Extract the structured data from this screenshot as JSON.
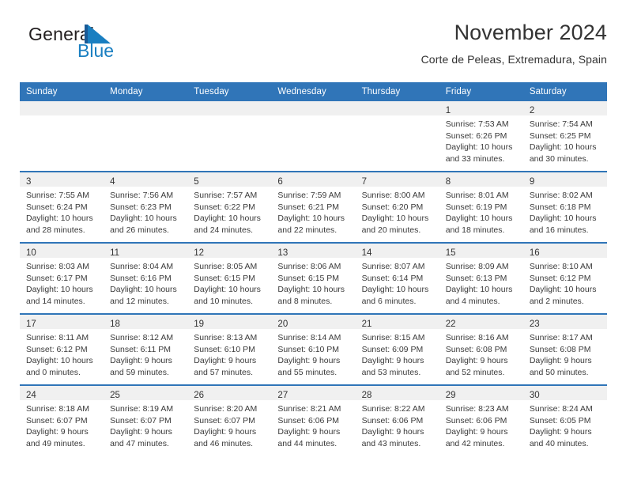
{
  "brand": {
    "name_part1": "General",
    "name_part2": "Blue",
    "accent_color": "#1a7fc1"
  },
  "header": {
    "title": "November 2024",
    "subtitle": "Corte de Peleas, Extremadura, Spain"
  },
  "theme": {
    "header_blue": "#3075b8",
    "daynum_band": "#f0f0f0",
    "text": "#333333"
  },
  "calendar": {
    "weekday_headers": [
      "Sunday",
      "Monday",
      "Tuesday",
      "Wednesday",
      "Thursday",
      "Friday",
      "Saturday"
    ],
    "weeks": [
      [
        {
          "day": "",
          "sunrise": "",
          "sunset": "",
          "daylight": ""
        },
        {
          "day": "",
          "sunrise": "",
          "sunset": "",
          "daylight": ""
        },
        {
          "day": "",
          "sunrise": "",
          "sunset": "",
          "daylight": ""
        },
        {
          "day": "",
          "sunrise": "",
          "sunset": "",
          "daylight": ""
        },
        {
          "day": "",
          "sunrise": "",
          "sunset": "",
          "daylight": ""
        },
        {
          "day": "1",
          "sunrise": "Sunrise: 7:53 AM",
          "sunset": "Sunset: 6:26 PM",
          "daylight": "Daylight: 10 hours and 33 minutes."
        },
        {
          "day": "2",
          "sunrise": "Sunrise: 7:54 AM",
          "sunset": "Sunset: 6:25 PM",
          "daylight": "Daylight: 10 hours and 30 minutes."
        }
      ],
      [
        {
          "day": "3",
          "sunrise": "Sunrise: 7:55 AM",
          "sunset": "Sunset: 6:24 PM",
          "daylight": "Daylight: 10 hours and 28 minutes."
        },
        {
          "day": "4",
          "sunrise": "Sunrise: 7:56 AM",
          "sunset": "Sunset: 6:23 PM",
          "daylight": "Daylight: 10 hours and 26 minutes."
        },
        {
          "day": "5",
          "sunrise": "Sunrise: 7:57 AM",
          "sunset": "Sunset: 6:22 PM",
          "daylight": "Daylight: 10 hours and 24 minutes."
        },
        {
          "day": "6",
          "sunrise": "Sunrise: 7:59 AM",
          "sunset": "Sunset: 6:21 PM",
          "daylight": "Daylight: 10 hours and 22 minutes."
        },
        {
          "day": "7",
          "sunrise": "Sunrise: 8:00 AM",
          "sunset": "Sunset: 6:20 PM",
          "daylight": "Daylight: 10 hours and 20 minutes."
        },
        {
          "day": "8",
          "sunrise": "Sunrise: 8:01 AM",
          "sunset": "Sunset: 6:19 PM",
          "daylight": "Daylight: 10 hours and 18 minutes."
        },
        {
          "day": "9",
          "sunrise": "Sunrise: 8:02 AM",
          "sunset": "Sunset: 6:18 PM",
          "daylight": "Daylight: 10 hours and 16 minutes."
        }
      ],
      [
        {
          "day": "10",
          "sunrise": "Sunrise: 8:03 AM",
          "sunset": "Sunset: 6:17 PM",
          "daylight": "Daylight: 10 hours and 14 minutes."
        },
        {
          "day": "11",
          "sunrise": "Sunrise: 8:04 AM",
          "sunset": "Sunset: 6:16 PM",
          "daylight": "Daylight: 10 hours and 12 minutes."
        },
        {
          "day": "12",
          "sunrise": "Sunrise: 8:05 AM",
          "sunset": "Sunset: 6:15 PM",
          "daylight": "Daylight: 10 hours and 10 minutes."
        },
        {
          "day": "13",
          "sunrise": "Sunrise: 8:06 AM",
          "sunset": "Sunset: 6:15 PM",
          "daylight": "Daylight: 10 hours and 8 minutes."
        },
        {
          "day": "14",
          "sunrise": "Sunrise: 8:07 AM",
          "sunset": "Sunset: 6:14 PM",
          "daylight": "Daylight: 10 hours and 6 minutes."
        },
        {
          "day": "15",
          "sunrise": "Sunrise: 8:09 AM",
          "sunset": "Sunset: 6:13 PM",
          "daylight": "Daylight: 10 hours and 4 minutes."
        },
        {
          "day": "16",
          "sunrise": "Sunrise: 8:10 AM",
          "sunset": "Sunset: 6:12 PM",
          "daylight": "Daylight: 10 hours and 2 minutes."
        }
      ],
      [
        {
          "day": "17",
          "sunrise": "Sunrise: 8:11 AM",
          "sunset": "Sunset: 6:12 PM",
          "daylight": "Daylight: 10 hours and 0 minutes."
        },
        {
          "day": "18",
          "sunrise": "Sunrise: 8:12 AM",
          "sunset": "Sunset: 6:11 PM",
          "daylight": "Daylight: 9 hours and 59 minutes."
        },
        {
          "day": "19",
          "sunrise": "Sunrise: 8:13 AM",
          "sunset": "Sunset: 6:10 PM",
          "daylight": "Daylight: 9 hours and 57 minutes."
        },
        {
          "day": "20",
          "sunrise": "Sunrise: 8:14 AM",
          "sunset": "Sunset: 6:10 PM",
          "daylight": "Daylight: 9 hours and 55 minutes."
        },
        {
          "day": "21",
          "sunrise": "Sunrise: 8:15 AM",
          "sunset": "Sunset: 6:09 PM",
          "daylight": "Daylight: 9 hours and 53 minutes."
        },
        {
          "day": "22",
          "sunrise": "Sunrise: 8:16 AM",
          "sunset": "Sunset: 6:08 PM",
          "daylight": "Daylight: 9 hours and 52 minutes."
        },
        {
          "day": "23",
          "sunrise": "Sunrise: 8:17 AM",
          "sunset": "Sunset: 6:08 PM",
          "daylight": "Daylight: 9 hours and 50 minutes."
        }
      ],
      [
        {
          "day": "24",
          "sunrise": "Sunrise: 8:18 AM",
          "sunset": "Sunset: 6:07 PM",
          "daylight": "Daylight: 9 hours and 49 minutes."
        },
        {
          "day": "25",
          "sunrise": "Sunrise: 8:19 AM",
          "sunset": "Sunset: 6:07 PM",
          "daylight": "Daylight: 9 hours and 47 minutes."
        },
        {
          "day": "26",
          "sunrise": "Sunrise: 8:20 AM",
          "sunset": "Sunset: 6:07 PM",
          "daylight": "Daylight: 9 hours and 46 minutes."
        },
        {
          "day": "27",
          "sunrise": "Sunrise: 8:21 AM",
          "sunset": "Sunset: 6:06 PM",
          "daylight": "Daylight: 9 hours and 44 minutes."
        },
        {
          "day": "28",
          "sunrise": "Sunrise: 8:22 AM",
          "sunset": "Sunset: 6:06 PM",
          "daylight": "Daylight: 9 hours and 43 minutes."
        },
        {
          "day": "29",
          "sunrise": "Sunrise: 8:23 AM",
          "sunset": "Sunset: 6:06 PM",
          "daylight": "Daylight: 9 hours and 42 minutes."
        },
        {
          "day": "30",
          "sunrise": "Sunrise: 8:24 AM",
          "sunset": "Sunset: 6:05 PM",
          "daylight": "Daylight: 9 hours and 40 minutes."
        }
      ]
    ]
  }
}
